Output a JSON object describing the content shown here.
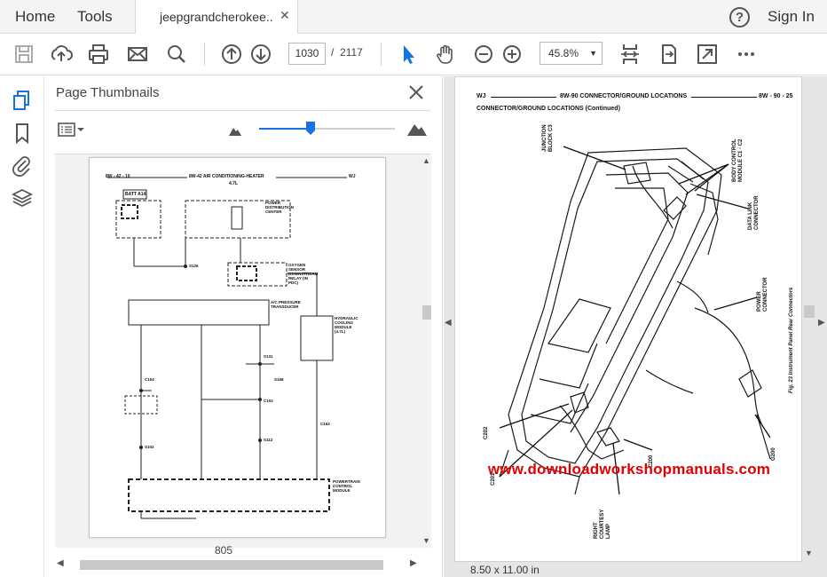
{
  "app": {
    "menu_home": "Home",
    "menu_tools": "Tools",
    "tab_name": "jeepgrandcherokee...",
    "help_label": "?",
    "sign_in": "Sign In"
  },
  "toolbar": {
    "page_current": "1030",
    "page_separator": "/",
    "page_total": "2117",
    "zoom": "45.8%"
  },
  "thumbnails_panel": {
    "title": "Page Thumbnails",
    "page_label": "805",
    "slider_value": 0.38,
    "thumb_page": {
      "header_left": "8W - 42 - 10",
      "header_center": "8W-42 AIR CONDITIONING-HEATER",
      "header_sub": "4.7L",
      "header_right": "WJ",
      "batt": "BATT A14",
      "labels": [
        "POWER DISTRIBUTION CENTER",
        "OXYGEN SENSOR DOWNSTREAM RELAY (IN PDC)",
        "A/C PRESSURE TRANSDUCER",
        "HYDRAULIC COOLING MODULE (4.7L)",
        "POWERTRAIN CONTROL MODULE",
        "C104",
        "C102",
        "C162",
        "S131",
        "S168",
        "S112",
        "S102",
        "S126"
      ]
    }
  },
  "document": {
    "header_left": "WJ",
    "header_center": "8W-90 CONNECTOR/GROUND LOCATIONS",
    "header_right": "8W - 90 - 25",
    "subheader": "CONNECTOR/GROUND LOCATIONS (Continued)",
    "callouts": [
      "JUNCTION BLOCK C3",
      "BODY CONTROL MODULE C1 - C2",
      "DATA LINK CONNECTOR",
      "POWER CONNECTOR",
      "C202",
      "C201",
      "RIGHT COURTESY LAMP",
      "C200",
      "G200"
    ],
    "figure_caption": "Fig. 23 Instrument Panel Rear Connectors",
    "watermark": "www.downloadworkshopmanuals.com",
    "page_size": "8.50 x 11.00 in"
  },
  "colors": {
    "accent": "#1473e6",
    "watermark": "#e00000"
  }
}
